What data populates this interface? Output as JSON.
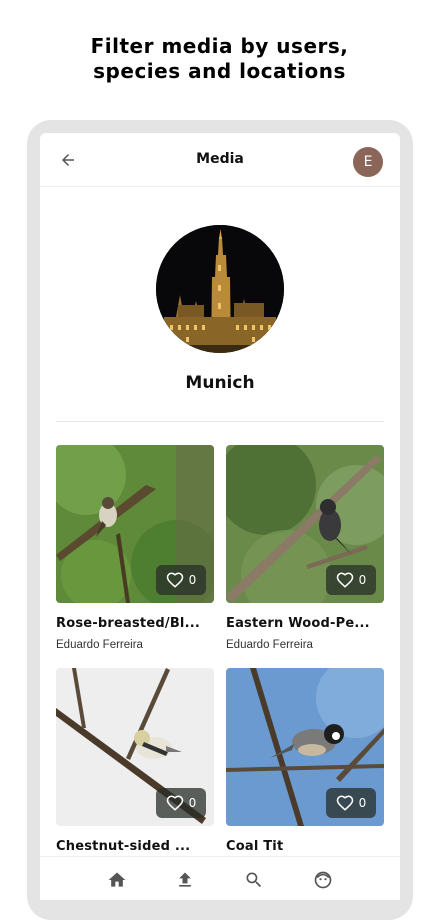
{
  "promo": {
    "line1": "Filter media by users,",
    "line2": "species and locations"
  },
  "appbar": {
    "title": "Media",
    "avatar_initial": "E",
    "back_icon": "arrow-left-icon"
  },
  "location": {
    "name": "Munich"
  },
  "media": [
    {
      "title": "Rose-breasted/Bl...",
      "user": "Eduardo Ferreira",
      "likes": "0"
    },
    {
      "title": "Eastern Wood-Pe...",
      "user": "Eduardo Ferreira",
      "likes": "0"
    },
    {
      "title": "Chestnut-sided ...",
      "user": "",
      "likes": "0"
    },
    {
      "title": "Coal Tit",
      "user": "",
      "likes": "0"
    }
  ],
  "nav": {
    "items": [
      "home-icon",
      "upload-icon",
      "search-icon",
      "profile-icon"
    ]
  },
  "colors": {
    "avatar": "#8a6558",
    "frame": "#e4e4e4",
    "like_badge": "#2d322d"
  }
}
